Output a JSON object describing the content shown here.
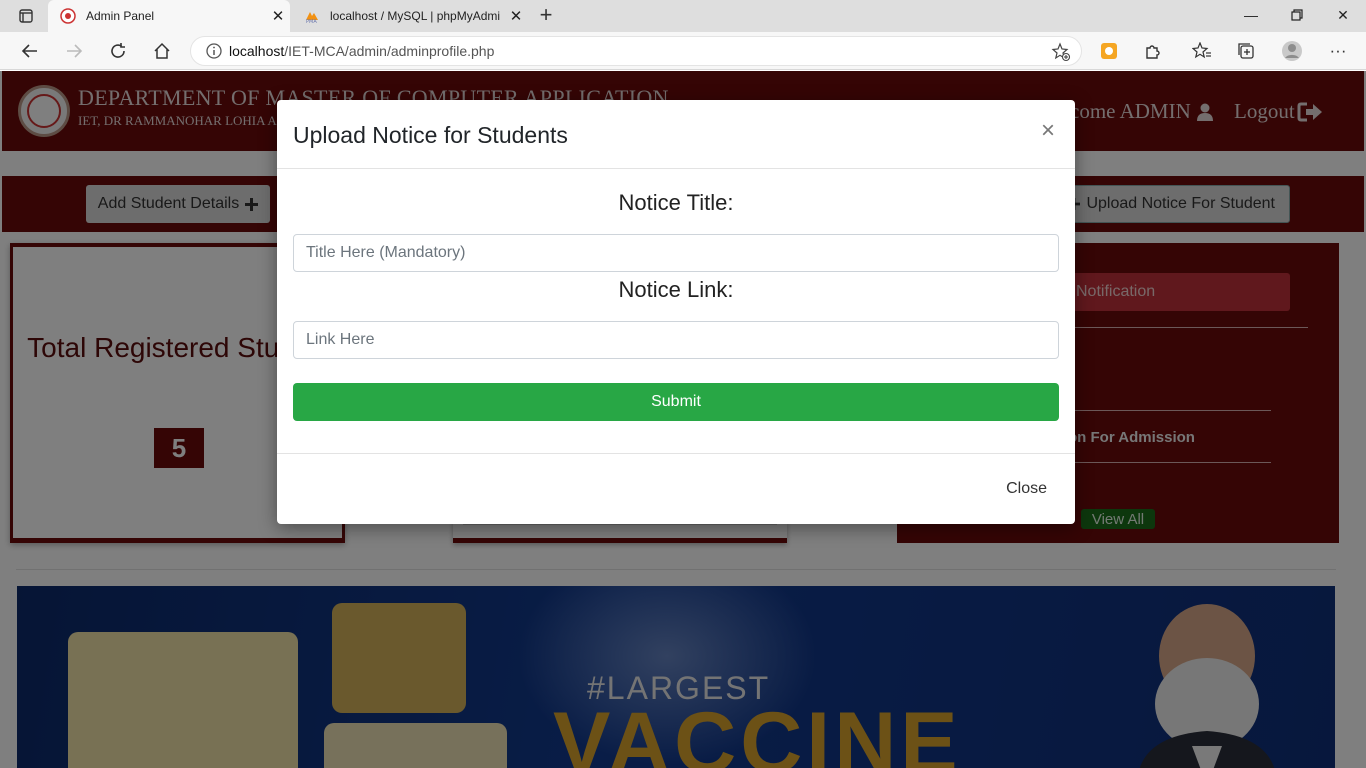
{
  "browser": {
    "tabs": [
      {
        "title": "Admin Panel",
        "active": true
      },
      {
        "title": "localhost / MySQL | phpMyAdmi",
        "active": false
      }
    ],
    "url_host": "localhost",
    "url_path": "/IET-MCA/admin/adminprofile.php"
  },
  "header": {
    "dept_title": "DEPARTMENT OF MASTER OF COMPUTER APPLICATION",
    "dept_subtitle": "IET, DR RAMMANOHAR LOHIA A",
    "welcome": "come ADMIN",
    "logout": "Logout"
  },
  "nav": {
    "add_student": "Add Student Details",
    "upload_notice": "Upload Notice For Student"
  },
  "stats": {
    "total_label": "Total Registered Student",
    "total_value": "5"
  },
  "notifications": {
    "button": "Notification",
    "item_text": "on For Admission",
    "view_all": "View All"
  },
  "banner": {
    "hashtag": "#LARGEST",
    "headline": "VACCINE"
  },
  "modal": {
    "title": "Upload Notice for Students",
    "close_symbol": "×",
    "title_label": "Notice Title:",
    "title_placeholder": "Title Here (Mandatory)",
    "link_label": "Notice Link:",
    "link_placeholder": "Link Here",
    "submit": "Submit",
    "close": "Close"
  },
  "colors": {
    "maroon": "#6b0a0a",
    "success": "#28a745",
    "danger": "#c0313a"
  }
}
